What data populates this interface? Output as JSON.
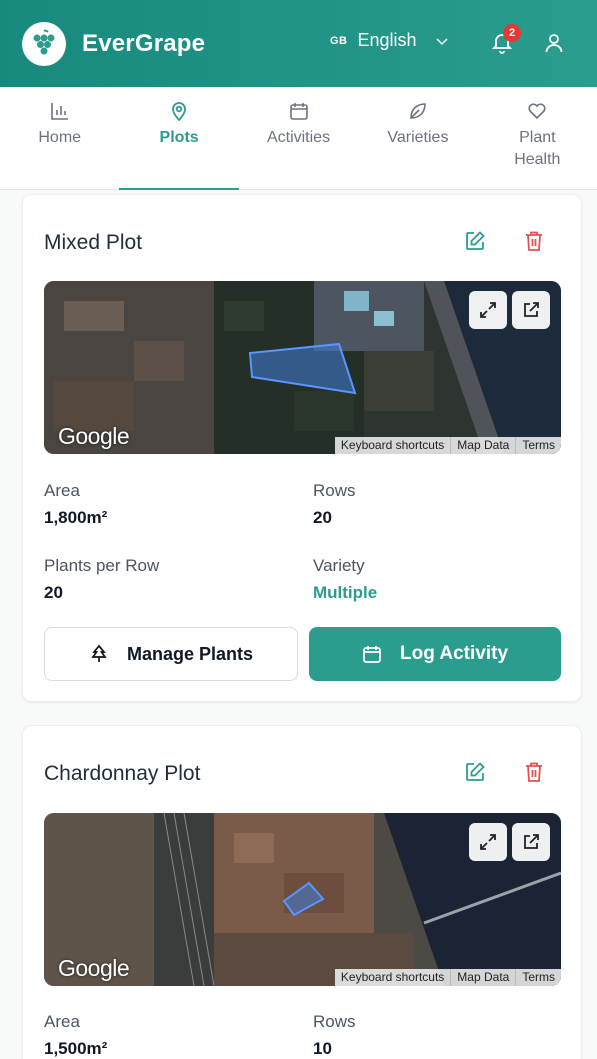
{
  "app": {
    "name": "EverGrape"
  },
  "language": {
    "code": "GB",
    "name": "English"
  },
  "notifications": {
    "count": "2"
  },
  "tabs": [
    {
      "label": "Home",
      "icon": "bar-chart-icon"
    },
    {
      "label": "Plots",
      "icon": "map-pin-icon",
      "active": true
    },
    {
      "label": "Activities",
      "icon": "calendar-icon"
    },
    {
      "label": "Varieties",
      "icon": "leaf-icon"
    },
    {
      "label": "Plant Health",
      "icon": "heart-icon"
    }
  ],
  "map_labels": {
    "google": "Google",
    "keyboard": "Keyboard shortcuts",
    "map_data": "Map Data",
    "terms": "Terms"
  },
  "plots": [
    {
      "name": "Mixed Plot",
      "area_label": "Area",
      "area_value": "1,800m²",
      "rows_label": "Rows",
      "rows_value": "20",
      "ppr_label": "Plants per Row",
      "ppr_value": "20",
      "variety_label": "Variety",
      "variety_value": "Multiple",
      "manage_label": "Manage Plants",
      "log_label": "Log Activity"
    },
    {
      "name": "Chardonnay Plot",
      "area_label": "Area",
      "area_value": "1,500m²",
      "rows_label": "Rows",
      "rows_value": "10"
    }
  ],
  "colors": {
    "primary": "#2a9d8f",
    "danger": "#e05252",
    "header": "#188a7d"
  }
}
